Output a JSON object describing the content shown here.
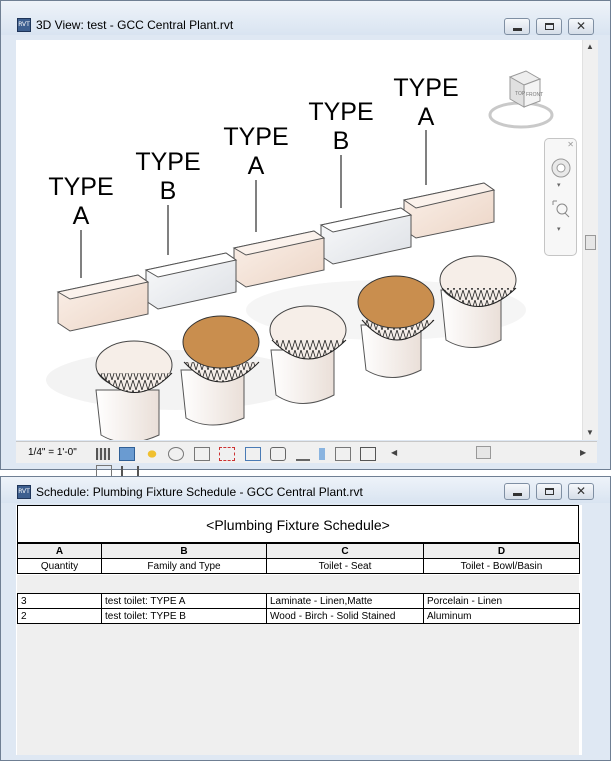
{
  "window_3d": {
    "title": "3D View: test - GCC Central Plant.rvt",
    "scale": "1/4\" = 1'-0\""
  },
  "type_labels": [
    {
      "line1": "TYPE",
      "line2": "A"
    },
    {
      "line1": "TYPE",
      "line2": "B"
    },
    {
      "line1": "TYPE",
      "line2": "A"
    },
    {
      "line1": "TYPE",
      "line2": "B"
    },
    {
      "line1": "TYPE",
      "line2": "A"
    }
  ],
  "viewcube": {
    "faces": [
      "TOP",
      "FRONT"
    ]
  },
  "window_schedule": {
    "title": "Schedule: Plumbing Fixture Schedule - GCC Central Plant.rvt"
  },
  "schedule": {
    "title": "<Plumbing Fixture Schedule>",
    "letters": [
      "A",
      "B",
      "C",
      "D"
    ],
    "headers": [
      "Quantity",
      "Family and Type",
      "Toilet - Seat",
      "Toilet - Bowl/Basin"
    ],
    "rows": [
      [
        "3",
        "test toilet: TYPE A",
        "Laminate - Linen,Matte",
        "Porcelain - Linen"
      ],
      [
        "2",
        "test toilet: TYPE B",
        "Wood - Birch - Solid Stained",
        "Aluminum"
      ]
    ]
  },
  "colors": {
    "tank_a": "#f7e7dc",
    "tank_b": "#f1f2f4",
    "wood_seat": "#c98e4e"
  }
}
